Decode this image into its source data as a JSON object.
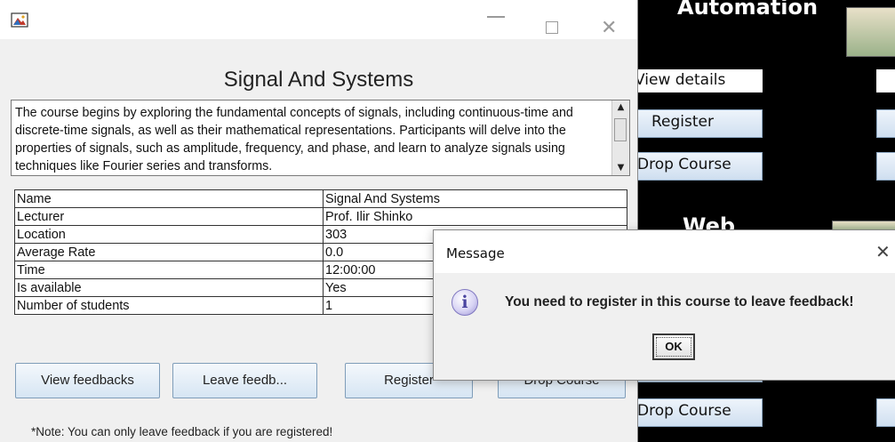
{
  "background_app": {
    "heading_automation": "Automation",
    "heading_web": "Web",
    "view_details_label": "View details",
    "register_label": "Register",
    "drop_course_label": "Drop Course",
    "drop_course_label_2": "Drop Course"
  },
  "course_window": {
    "title": "Signal And Systems",
    "description": "The course begins by exploring the fundamental concepts of signals, including continuous-time and discrete-time signals, as well as their mathematical representations. Participants will delve into the properties of signals, such as amplitude, frequency, and phase, and learn to analyze signals using techniques like Fourier series and transforms.",
    "details": [
      {
        "label": "Name",
        "value": "Signal And Systems"
      },
      {
        "label": "Lecturer",
        "value": "Prof. Ilir Shinko"
      },
      {
        "label": "Location",
        "value": "303"
      },
      {
        "label": "Average Rate",
        "value": "0.0"
      },
      {
        "label": "Time",
        "value": "12:00:00"
      },
      {
        "label": "Is available",
        "value": "Yes"
      },
      {
        "label": "Number of students",
        "value": "1"
      }
    ],
    "buttons": {
      "view_feedbacks": "View feedbacks",
      "leave_feedback": "Leave feedb...",
      "register": "Register",
      "drop_course": "Drop Course"
    },
    "note": "*Note: You can only leave feedback if you are registered!"
  },
  "dialog": {
    "title": "Message",
    "message": "You need to register in this course to leave feedback!",
    "ok_label": "OK"
  }
}
